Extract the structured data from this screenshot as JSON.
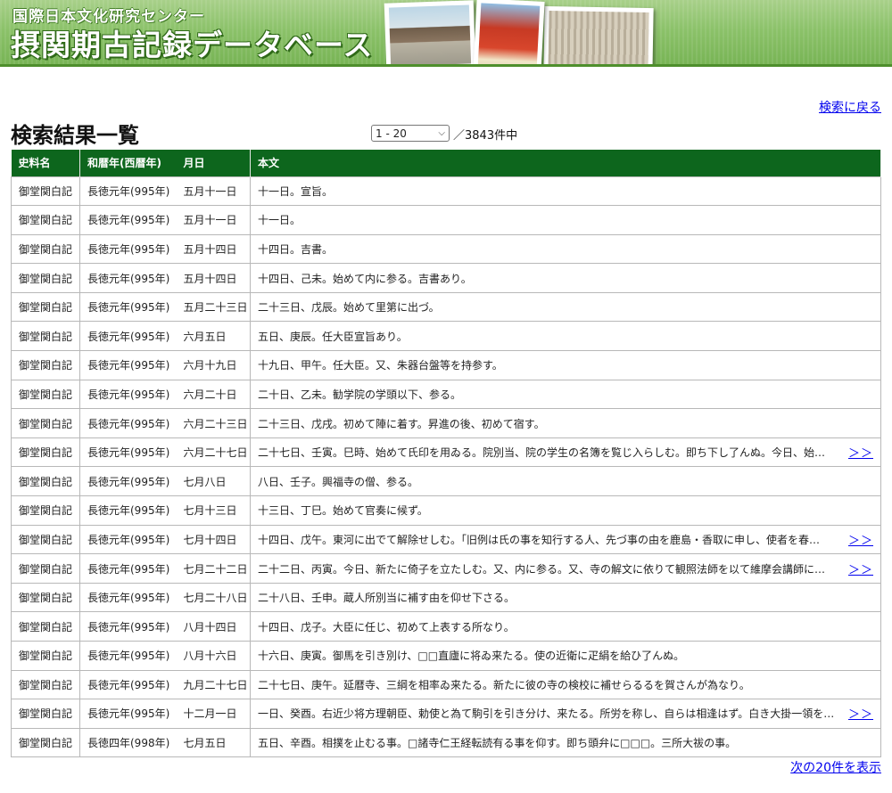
{
  "header": {
    "org_name": "国際日本文化研究センター",
    "site_title": "摂関期古記録データベース"
  },
  "nav": {
    "back_label": "検索に戻る",
    "next_label": "次の20件を表示"
  },
  "results": {
    "heading": "検索結果一覧",
    "range_selected": "1 - 20",
    "total_text": "／3843件中",
    "columns": [
      "史料名",
      "和暦年(西暦年)",
      "月日",
      "本文"
    ],
    "more_label": "＞＞",
    "rows": [
      {
        "source": "御堂関白記",
        "era": "長徳元年(995年)",
        "date": "五月十一日",
        "text": "十一日。宣旨。",
        "more": false
      },
      {
        "source": "御堂関白記",
        "era": "長徳元年(995年)",
        "date": "五月十一日",
        "text": "十一日。",
        "more": false
      },
      {
        "source": "御堂関白記",
        "era": "長徳元年(995年)",
        "date": "五月十四日",
        "text": "十四日。吉書。",
        "more": false
      },
      {
        "source": "御堂関白記",
        "era": "長徳元年(995年)",
        "date": "五月十四日",
        "text": "十四日、己未。始めて内に参る。吉書あり。",
        "more": false
      },
      {
        "source": "御堂関白記",
        "era": "長徳元年(995年)",
        "date": "五月二十三日",
        "text": "二十三日、戊辰。始めて里第に出づ。",
        "more": false
      },
      {
        "source": "御堂関白記",
        "era": "長徳元年(995年)",
        "date": "六月五日",
        "text": "五日、庚辰。任大臣宣旨あり。",
        "more": false
      },
      {
        "source": "御堂関白記",
        "era": "長徳元年(995年)",
        "date": "六月十九日",
        "text": "十九日、甲午。任大臣。又、朱器台盤等を持参す。",
        "more": false
      },
      {
        "source": "御堂関白記",
        "era": "長徳元年(995年)",
        "date": "六月二十日",
        "text": "二十日、乙未。勧学院の学頭以下、参る。",
        "more": false
      },
      {
        "source": "御堂関白記",
        "era": "長徳元年(995年)",
        "date": "六月二十三日",
        "text": "二十三日、戊戌。初めて陣に着す。昇進の後、初めて宿す。",
        "more": false
      },
      {
        "source": "御堂関白記",
        "era": "長徳元年(995年)",
        "date": "六月二十七日",
        "text": "二十七日、壬寅。巳時、始めて氏印を用ゐる。院別当、院の学生の名簿を覧じ入らしむ。即ち下し了んぬ。今日、始…",
        "more": true
      },
      {
        "source": "御堂関白記",
        "era": "長徳元年(995年)",
        "date": "七月八日",
        "text": "八日、壬子。興福寺の僧、参る。",
        "more": false
      },
      {
        "source": "御堂関白記",
        "era": "長徳元年(995年)",
        "date": "七月十三日",
        "text": "十三日、丁巳。始めて官奏に候ず。",
        "more": false
      },
      {
        "source": "御堂関白記",
        "era": "長徳元年(995年)",
        "date": "七月十四日",
        "text": "十四日、戊午。東河に出でて解除せしむ。「旧例は氏の事を知行する人、先づ事の由を鹿島・香取に申し、使者を春…",
        "more": true
      },
      {
        "source": "御堂関白記",
        "era": "長徳元年(995年)",
        "date": "七月二十二日",
        "text": "二十二日、丙寅。今日、新たに倚子を立たしむ。又、内に参る。又、寺の解文に依りて観照法師を以て維摩会講師に…",
        "more": true
      },
      {
        "source": "御堂関白記",
        "era": "長徳元年(995年)",
        "date": "七月二十八日",
        "text": "二十八日、壬申。蔵人所別当に補す由を仰せ下さる。",
        "more": false
      },
      {
        "source": "御堂関白記",
        "era": "長徳元年(995年)",
        "date": "八月十四日",
        "text": "十四日、戊子。大臣に任じ、初めて上表する所なり。",
        "more": false
      },
      {
        "source": "御堂関白記",
        "era": "長徳元年(995年)",
        "date": "八月十六日",
        "text": "十六日、庚寅。御馬を引き別け、□□直廬に将ゐ来たる。使の近衛に疋絹を給ひ了んぬ。",
        "more": false
      },
      {
        "source": "御堂関白記",
        "era": "長徳元年(995年)",
        "date": "九月二十七日",
        "text": "二十七日、庚午。延暦寺、三綱を相率ゐ来たる。新たに彼の寺の検校に補せらるるを賀さんが為なり。",
        "more": false
      },
      {
        "source": "御堂関白記",
        "era": "長徳元年(995年)",
        "date": "十二月一日",
        "text": "一日、癸酉。右近少将方理朝臣、勅使と為て駒引を引き分け、来たる。所労を称し、自らは相逢はず。白き大掛一領を…",
        "more": true
      },
      {
        "source": "御堂関白記",
        "era": "長徳四年(998年)",
        "date": "七月五日",
        "text": "五日、辛酉。相撲を止むる事。□諸寺仁王経転読有る事を仰す。即ち頭弁に□□□。三所大祓の事。",
        "more": false
      }
    ]
  }
}
